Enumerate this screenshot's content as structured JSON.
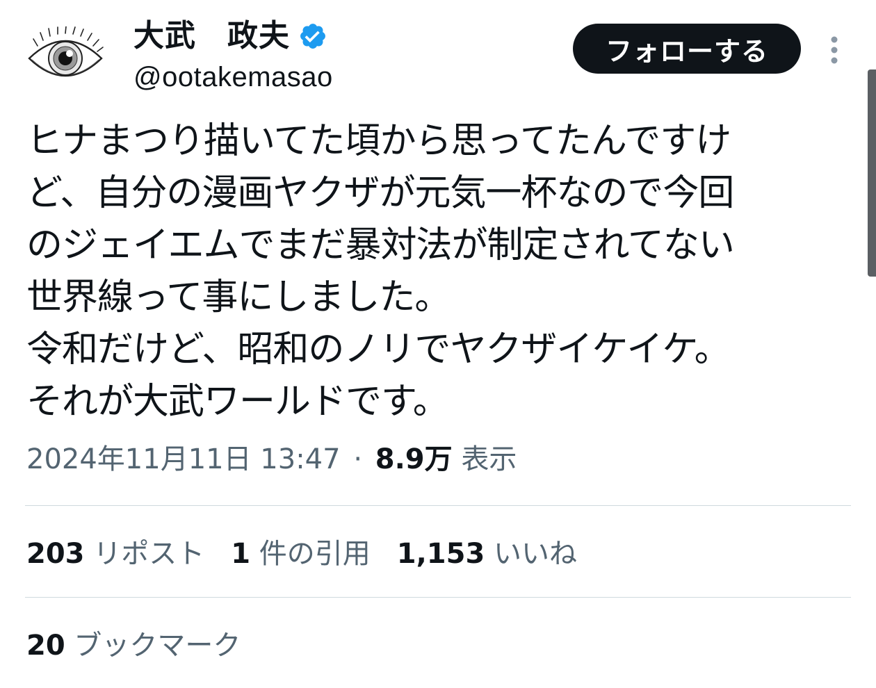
{
  "author": {
    "display_name": "大武　政夫",
    "handle": "@ootakemasao",
    "verified": true,
    "avatar_icon": "eye-icon"
  },
  "header": {
    "follow_label": "フォローする",
    "more_icon": "more-vertical-icon"
  },
  "tweet": {
    "lines": [
      "ヒナまつり描いてた頃から思ってたんですけ",
      "ど、自分の漫画ヤクザが元気一杯なので今回",
      "のジェイエムでまだ暴対法が制定されてない",
      "世界線って事にしました。",
      "令和だけど、昭和のノリでヤクザイケイケ。",
      "それが大武ワールドです。"
    ]
  },
  "meta": {
    "timestamp": "2024年11月11日 13:47",
    "separator": "·",
    "views_count": "8.9万",
    "views_label": "表示"
  },
  "stats": {
    "reposts": {
      "count": "203",
      "label": "リポスト"
    },
    "quotes": {
      "count": "1",
      "label": "件の引用"
    },
    "likes": {
      "count": "1,153",
      "label": "いいね"
    },
    "bookmarks": {
      "count": "20",
      "label": "ブックマーク"
    }
  },
  "colors": {
    "text": "#0f1419",
    "secondary_text": "#536471",
    "verified_blue": "#1d9bf0",
    "divider": "#cfd9de",
    "button_bg": "#0f1419"
  }
}
